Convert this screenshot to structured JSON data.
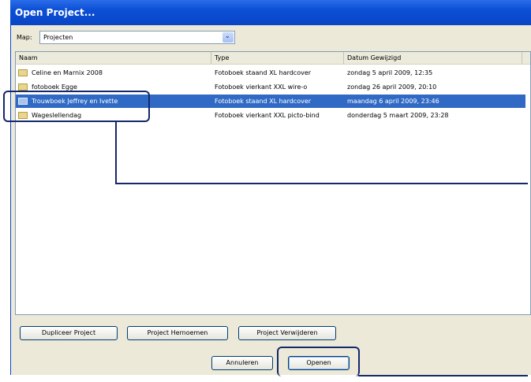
{
  "window": {
    "title": "Open Project..."
  },
  "folder": {
    "label": "Map:",
    "value": "Projecten"
  },
  "columns": [
    "Naam",
    "Type",
    "Datum Gewijzigd"
  ],
  "rows": [
    {
      "name": "Celine en Marnix 2008",
      "type": "Fotoboek staand XL hardcover",
      "date": "zondag 5 april 2009, 12:35",
      "selected": false
    },
    {
      "name": "fotoboek Egge",
      "type": "Fotoboek vierkant XXL wire-o",
      "date": "zondag 26 april 2009, 20:10",
      "selected": false
    },
    {
      "name": "Trouwboek Jeffrey en Ivette",
      "type": "Fotoboek staand XL hardcover",
      "date": "maandag 6 april 2009, 23:46",
      "selected": true
    },
    {
      "name": "Wageslellendag",
      "type": "Fotoboek vierkant XXL picto-bind",
      "date": "donderdag 5 maart 2009, 23:28",
      "selected": false
    }
  ],
  "actions": {
    "duplicate": "Dupliceer Project",
    "rename": "Project Hernoemen",
    "delete": "Project Verwijderen",
    "cancel": "Annuleren",
    "open": "Openen"
  }
}
